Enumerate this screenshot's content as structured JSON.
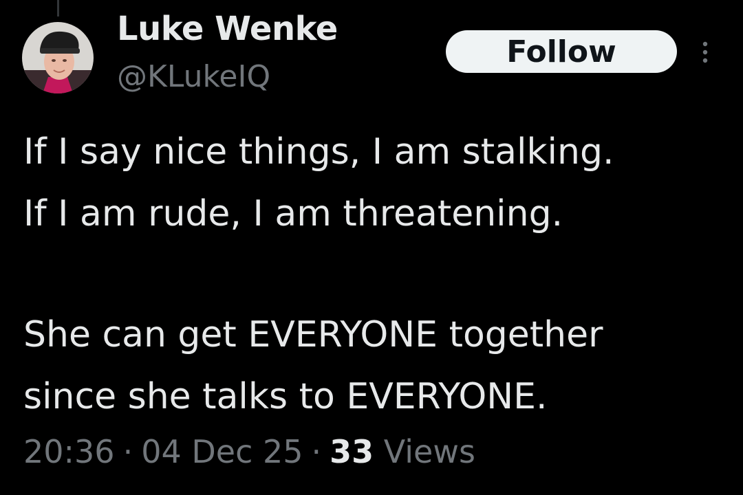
{
  "user": {
    "display_name": "Luke Wenke",
    "handle": "@KLukeIQ",
    "avatar_icon": "profile-photo"
  },
  "actions": {
    "follow_label": "Follow",
    "more_icon": "more-vertical-icon"
  },
  "tweet": {
    "lines": [
      "If I say nice things, I am stalking.",
      "If I am rude, I am threatening.",
      "",
      "She can get EVERYONE together",
      "since she talks to EVERYONE."
    ]
  },
  "meta": {
    "time": "20:36",
    "separator": "·",
    "date": "04 Dec 25",
    "views_count": "33",
    "views_label": "Views"
  },
  "colors": {
    "background": "#000000",
    "primary_text": "#e7e9ea",
    "secondary_text": "#71767b",
    "follow_bg": "#eff3f4",
    "follow_text": "#0f1419"
  }
}
